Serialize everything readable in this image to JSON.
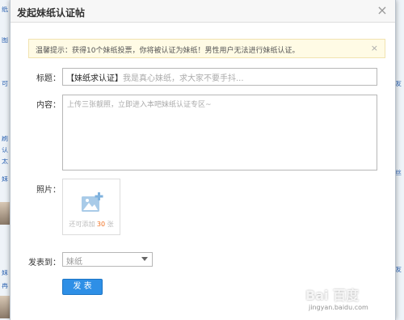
{
  "dialog": {
    "title": "发起妹纸认证帖",
    "close_glyph": "×"
  },
  "notice": {
    "text": "温馨提示：获得10个妹纸投票，你将被认证为妹纸！男性用户无法进行妹纸认证。",
    "close_glyph": "×"
  },
  "form": {
    "title_label": "标题：",
    "title_prefix": "【妹纸求认证】",
    "title_placeholder": "我是真心妹纸，求大家不要手抖...",
    "content_label": "内容：",
    "content_placeholder": "上传三张靓照，立即进入本吧妹纸认证专区~",
    "photo_label": "照片：",
    "photo_hint_prefix": "还可添加",
    "photo_hint_count": "30",
    "photo_hint_suffix": "张",
    "post_to_label": "发表到：",
    "post_to_value": "妹纸",
    "submit_label": "发 表"
  },
  "watermark": {
    "logo": "Bai 百度",
    "sub": "jingyan.baidu.com"
  },
  "background": {
    "left_glyphs": [
      "纸",
      "图",
      "可",
      "刷",
      "认",
      "太",
      "妹",
      "妹",
      "再"
    ],
    "right_glyphs": [
      "友",
      "丝",
      "友"
    ]
  },
  "colors": {
    "submit_bg": "#2e8fe6",
    "notice_bg": "#fffbe5",
    "photo_count": "#f07020"
  }
}
